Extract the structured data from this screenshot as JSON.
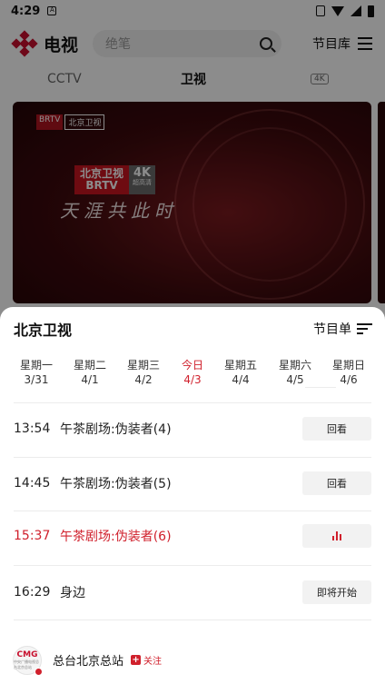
{
  "status_bar": {
    "time": "4:29"
  },
  "header": {
    "title": "电视",
    "search_placeholder": "绝笔",
    "guide_label": "节目库"
  },
  "category_tabs": [
    {
      "label": "CCTV",
      "active": false
    },
    {
      "label": "卫视",
      "active": true
    },
    {
      "label": "4K",
      "active": false
    }
  ],
  "player": {
    "small_logo": [
      "BRTV",
      "北京卫视"
    ],
    "logo_lines": [
      "北京卫视",
      "BRTV"
    ],
    "badge_4k": "4K",
    "badge_sub": "超高清",
    "slogan": "天涯共此时"
  },
  "sheet": {
    "channel": "北京卫视",
    "schedule_label": "节目单",
    "days": [
      {
        "weekday": "星期一",
        "date": "3/31",
        "today": false
      },
      {
        "weekday": "星期二",
        "date": "4/1",
        "today": false
      },
      {
        "weekday": "星期三",
        "date": "4/2",
        "today": false
      },
      {
        "weekday": "今日",
        "date": "4/3",
        "today": true
      },
      {
        "weekday": "星期五",
        "date": "4/4",
        "today": false
      },
      {
        "weekday": "星期六",
        "date": "4/5",
        "today": false
      },
      {
        "weekday": "星期日",
        "date": "4/6",
        "today": false
      }
    ],
    "programs": [
      {
        "time": "13:54",
        "title": "午茶剧场:伪装者(4)",
        "action": "回看",
        "live": false
      },
      {
        "time": "14:45",
        "title": "午茶剧场:伪装者(5)",
        "action": "回看",
        "live": false
      },
      {
        "time": "15:37",
        "title": "午茶剧场:伪装者(6)",
        "action": "",
        "live": true
      },
      {
        "time": "16:29",
        "title": "身边",
        "action": "即将开始",
        "live": false
      }
    ],
    "footer": {
      "avatar_text": "CMG",
      "avatar_sub": "中央广播电视总台北京总站",
      "station": "总台北京总站",
      "follow_label": "关注"
    }
  },
  "colors": {
    "accent": "#d0202c",
    "brand": "#c8102e"
  }
}
